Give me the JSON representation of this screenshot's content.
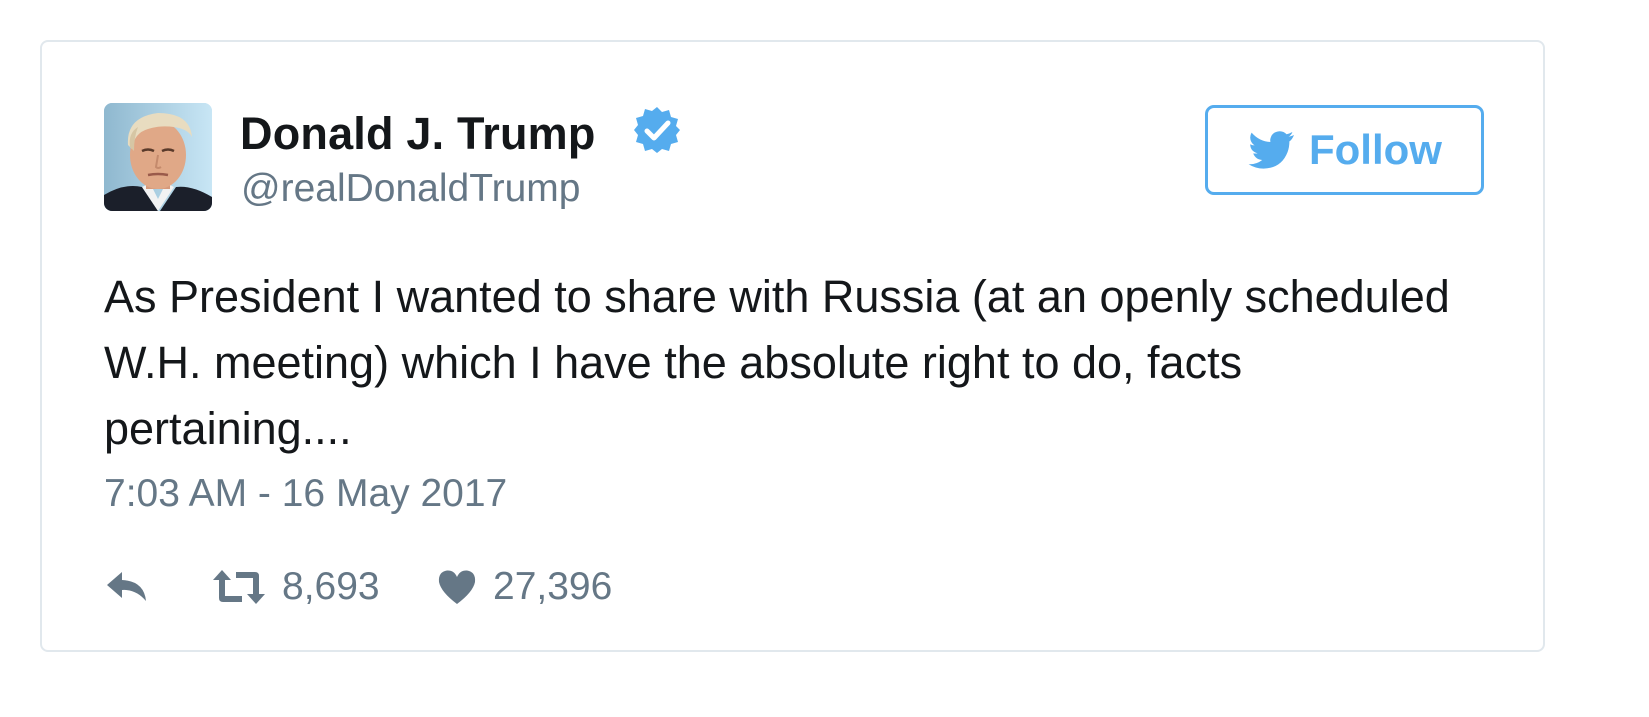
{
  "tweet": {
    "author": {
      "name": "Donald J. Trump",
      "handle": "@realDonaldTrump",
      "verified": true,
      "avatar_icon": "portrait-photo"
    },
    "follow_button": {
      "label": "Follow",
      "icon": "twitter-bird-icon"
    },
    "text": "As President I wanted to share with Russia (at an openly scheduled W.H. meeting) which I have the absolute right to do, facts pertaining....",
    "timestamp": "7:03 AM - 16 May 2017",
    "actions": {
      "reply": {
        "icon": "reply-icon"
      },
      "retweet": {
        "icon": "retweet-icon",
        "count": "8,693"
      },
      "like": {
        "icon": "heart-icon",
        "count": "27,396"
      }
    }
  },
  "colors": {
    "accent": "#55acee",
    "text_primary": "#14171a",
    "text_secondary": "#657786",
    "verified_badge": "#55acee",
    "card_border": "#e1e8ed"
  }
}
